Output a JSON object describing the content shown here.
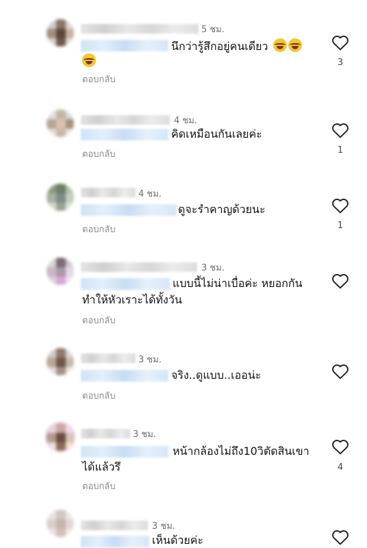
{
  "comments": [
    {
      "time": "5 ชม.",
      "text": "นึกว่ารู้สึกอยู่คนเดียว",
      "text2": "",
      "emoji_line1": [
        "face-with-tears-of-joy",
        "face-with-tears-of-joy"
      ],
      "emoji_line2": [
        "face-with-tears-of-joy"
      ],
      "reply": "ตอบกลับ",
      "likes": "3"
    },
    {
      "time": "4 ชม.",
      "text": "คิดเหมือนกันเลยค่ะ",
      "text2": "",
      "reply": "ตอบกลับ",
      "likes": "1"
    },
    {
      "time": "4 ชม.",
      "text": "ดูจะรำคาญด้วยนะ",
      "text2": "",
      "reply": "ตอบกลับ",
      "likes": "1"
    },
    {
      "time": "3 ชม.",
      "text": "แบบนี้ไม่น่าเบื่อค่ะ หยอกกัน",
      "text2": "ทำให้หัวเราะได้ทั้งวัน",
      "reply": "ตอบกลับ",
      "likes": ""
    },
    {
      "time": "3 ชม.",
      "text": "จริง..ดูแบบ..เออน่ะ",
      "text2": "",
      "reply": "ตอบกลับ",
      "likes": ""
    },
    {
      "time": "3 ชม.",
      "text": "หน้ากล้องไม่ถึง10วิตัดสินเขา",
      "text2": "ได้แล้วรึ",
      "reply": "ตอบกลับ",
      "likes": "4"
    },
    {
      "time": "3 ชม.",
      "text": "เห็นด้วยค่ะ",
      "text2": "",
      "reply": "",
      "likes": ""
    }
  ],
  "icons": {
    "like": "heart-outline-icon"
  },
  "colors": {
    "mention": "#cfe3f7",
    "timestamp": "#6e6e6e",
    "reply": "#8a8a8a"
  }
}
